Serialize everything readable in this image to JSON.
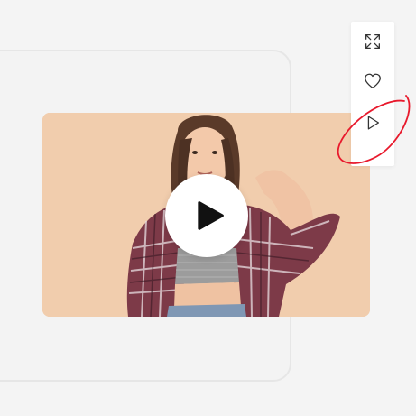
{
  "toolbar": {
    "buttons": [
      {
        "icon": "expand-icon",
        "action": "Expand"
      },
      {
        "icon": "heart-icon",
        "action": "Like"
      },
      {
        "icon": "play-icon",
        "action": "Play"
      }
    ]
  },
  "video": {
    "play_icon": "play-icon"
  },
  "colors": {
    "page_bg": "#f4f4f4",
    "video_bg": "#f1cdad",
    "annotation": "#e8192c",
    "icon_stroke": "#333333"
  }
}
